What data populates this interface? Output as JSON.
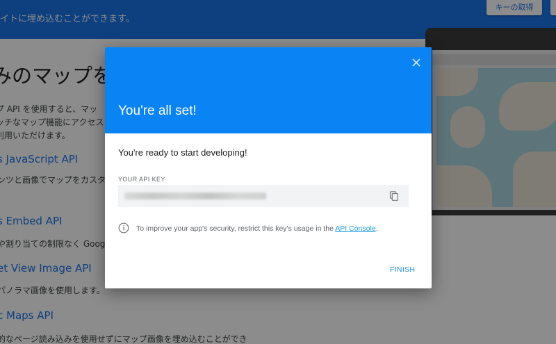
{
  "background": {
    "header_text": "イトに埋め込むことができます。",
    "get_key_button": "キーの取得",
    "hero_title": "みのマップを作",
    "intro_lines": [
      "プ API を使用すると、マッ",
      "ッチなマップ機能にアクセス",
      "利用いただけます。"
    ],
    "apis": [
      {
        "name": "s JavaScript API",
        "desc": "ンツと画像でマップをカスタ"
      },
      {
        "name": "s Embed API",
        "desc": "や割り当ての制限なく Googl"
      },
      {
        "name": "et View Image API",
        "desc": "パノラマ画像を使用します。"
      },
      {
        "name": "c Maps API",
        "desc": "的なページ読み込みを使用せずにマップ画像を埋め込むことができ"
      }
    ]
  },
  "dialog": {
    "title": "You're all set!",
    "ready_text": "You're ready to start developing!",
    "api_key_label": "YOUR API KEY",
    "security_note_prefix": "To improve your app's security, restrict this key's usage in the ",
    "api_console_link": "API Console",
    "security_note_suffix": ".",
    "finish_label": "FINISH"
  },
  "colors": {
    "dialog_header": "#0a84f5",
    "page_header": "#1a73e8",
    "link": "#1a9be0"
  },
  "icons": {
    "close": "close-icon",
    "copy": "copy-icon",
    "info": "info-icon"
  }
}
